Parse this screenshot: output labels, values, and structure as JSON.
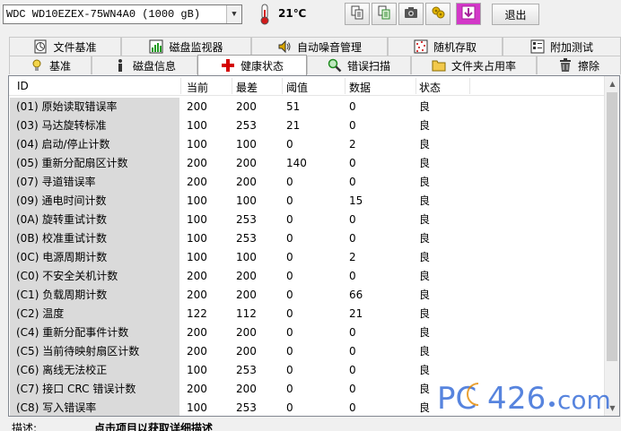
{
  "toolbar": {
    "drive_name": "WDC WD10EZEX-75WN4A0 (1000 gB)",
    "temperature": "21℃",
    "exit_label": "退出",
    "icons": [
      "copy-icon",
      "copy-all-icon",
      "camera-icon",
      "lock-icon",
      "save-icon"
    ]
  },
  "tabs_row1": [
    {
      "label": "文件基准",
      "icon": "file-benchmark-icon"
    },
    {
      "label": "磁盘监视器",
      "icon": "disk-monitor-icon"
    },
    {
      "label": "自动噪音管理",
      "icon": "speaker-icon"
    },
    {
      "label": "随机存取",
      "icon": "random-access-icon"
    },
    {
      "label": "附加测试",
      "icon": "extra-tests-icon"
    }
  ],
  "tabs_row2": [
    {
      "label": "基准",
      "icon": "benchmark-icon"
    },
    {
      "label": "磁盘信息",
      "icon": "info-icon"
    },
    {
      "label": "健康状态",
      "icon": "health-cross-icon"
    },
    {
      "label": "错误扫描",
      "icon": "magnifier-icon"
    },
    {
      "label": "文件夹占用率",
      "icon": "folder-icon"
    },
    {
      "label": "擦除",
      "icon": "trash-icon"
    }
  ],
  "active_tab": "健康状态",
  "table": {
    "columns": [
      "ID",
      "当前",
      "最差",
      "阈值",
      "数据",
      "状态"
    ],
    "rows": [
      [
        "(01) 原始读取错误率",
        "200",
        "200",
        "51",
        "0",
        "良"
      ],
      [
        "(03) 马达旋转标准",
        "100",
        "253",
        "21",
        "0",
        "良"
      ],
      [
        "(04) 启动/停止计数",
        "100",
        "100",
        "0",
        "2",
        "良"
      ],
      [
        "(05) 重新分配扇区计数",
        "200",
        "200",
        "140",
        "0",
        "良"
      ],
      [
        "(07) 寻道错误率",
        "200",
        "200",
        "0",
        "0",
        "良"
      ],
      [
        "(09) 通电时间计数",
        "100",
        "100",
        "0",
        "15",
        "良"
      ],
      [
        "(0A) 旋转重试计数",
        "100",
        "253",
        "0",
        "0",
        "良"
      ],
      [
        "(0B) 校准重试计数",
        "100",
        "253",
        "0",
        "0",
        "良"
      ],
      [
        "(0C) 电源周期计数",
        "100",
        "100",
        "0",
        "2",
        "良"
      ],
      [
        "(C0) 不安全关机计数",
        "200",
        "200",
        "0",
        "0",
        "良"
      ],
      [
        "(C1) 负载周期计数",
        "200",
        "200",
        "0",
        "66",
        "良"
      ],
      [
        "(C2) 温度",
        "122",
        "112",
        "0",
        "21",
        "良"
      ],
      [
        "(C4) 重新分配事件计数",
        "200",
        "200",
        "0",
        "0",
        "良"
      ],
      [
        "(C5) 当前待映射扇区计数",
        "200",
        "200",
        "0",
        "0",
        "良"
      ],
      [
        "(C6) 离线无法校正",
        "100",
        "253",
        "0",
        "0",
        "良"
      ],
      [
        "(C7) 接口 CRC 错误计数",
        "200",
        "200",
        "0",
        "0",
        "良"
      ],
      [
        "(C8) 写入错误率",
        "100",
        "253",
        "0",
        "0",
        "良"
      ]
    ]
  },
  "description": {
    "label": "描述:",
    "text": "点击项目以获取详细描述"
  },
  "watermark": "PC426.com"
}
